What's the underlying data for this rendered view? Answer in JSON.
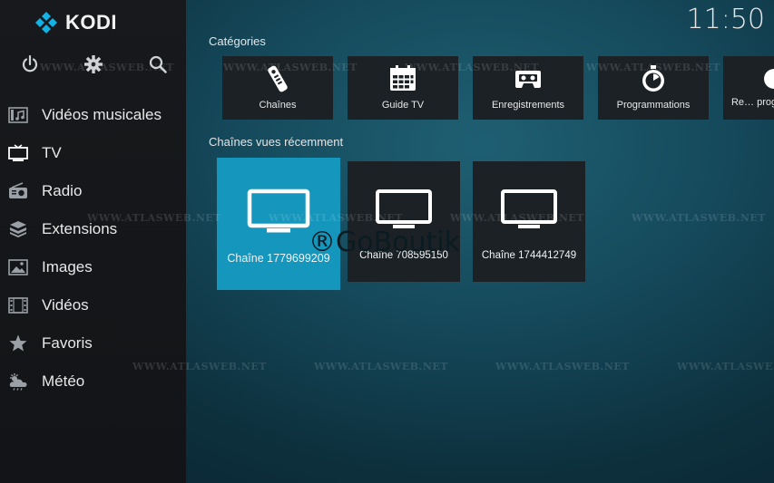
{
  "app": {
    "name": "KODI",
    "time": "11:50"
  },
  "sidebar": {
    "top_icons": [
      "power-icon",
      "settings-icon",
      "search-icon"
    ],
    "items": [
      {
        "label": "Vidéos musicales",
        "icon": "music-video-icon"
      },
      {
        "label": "TV",
        "icon": "tv-icon"
      },
      {
        "label": "Radio",
        "icon": "radio-icon"
      },
      {
        "label": "Extensions",
        "icon": "extensions-icon"
      },
      {
        "label": "Images",
        "icon": "images-icon"
      },
      {
        "label": "Vidéos",
        "icon": "videos-icon"
      },
      {
        "label": "Favoris",
        "icon": "star-icon"
      },
      {
        "label": "Météo",
        "icon": "weather-icon"
      }
    ]
  },
  "categories": {
    "title": "Catégories",
    "items": [
      {
        "label": "Chaînes",
        "icon": "remote-icon"
      },
      {
        "label": "Guide TV",
        "icon": "calendar-icon"
      },
      {
        "label": "Enregistrements",
        "icon": "cassette-icon"
      },
      {
        "label": "Programmations",
        "icon": "timer-icon"
      },
      {
        "label": "Re… program…",
        "icon": "partial-icon"
      }
    ]
  },
  "recent": {
    "title": "Chaînes vues récemment",
    "items": [
      {
        "label": "Chaîne 1779699209",
        "focused": true
      },
      {
        "label": "Chaîne 708595150",
        "focused": false
      },
      {
        "label": "Chaîne 1744412749",
        "focused": false
      }
    ]
  },
  "watermarks": {
    "site": "WWW.ATLASWEB.NET",
    "brand": "®GoBoutik"
  },
  "colors": {
    "accent": "#1596bd",
    "tile": "#1b2125",
    "sidebar": "#141619"
  }
}
